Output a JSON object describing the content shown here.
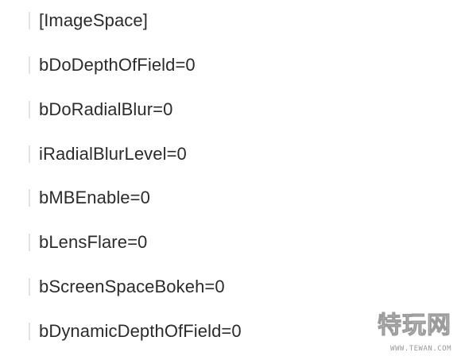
{
  "code_lines": [
    "[ImageSpace]",
    "bDoDepthOfField=0",
    "bDoRadialBlur=0",
    "iRadialBlurLevel=0",
    "bMBEnable=0",
    "bLensFlare=0",
    "bScreenSpaceBokeh=0",
    "bDynamicDepthOfField=0"
  ],
  "watermark": {
    "logo_text": "特玩网",
    "url_text": "WWW.TEWAN.COM"
  }
}
